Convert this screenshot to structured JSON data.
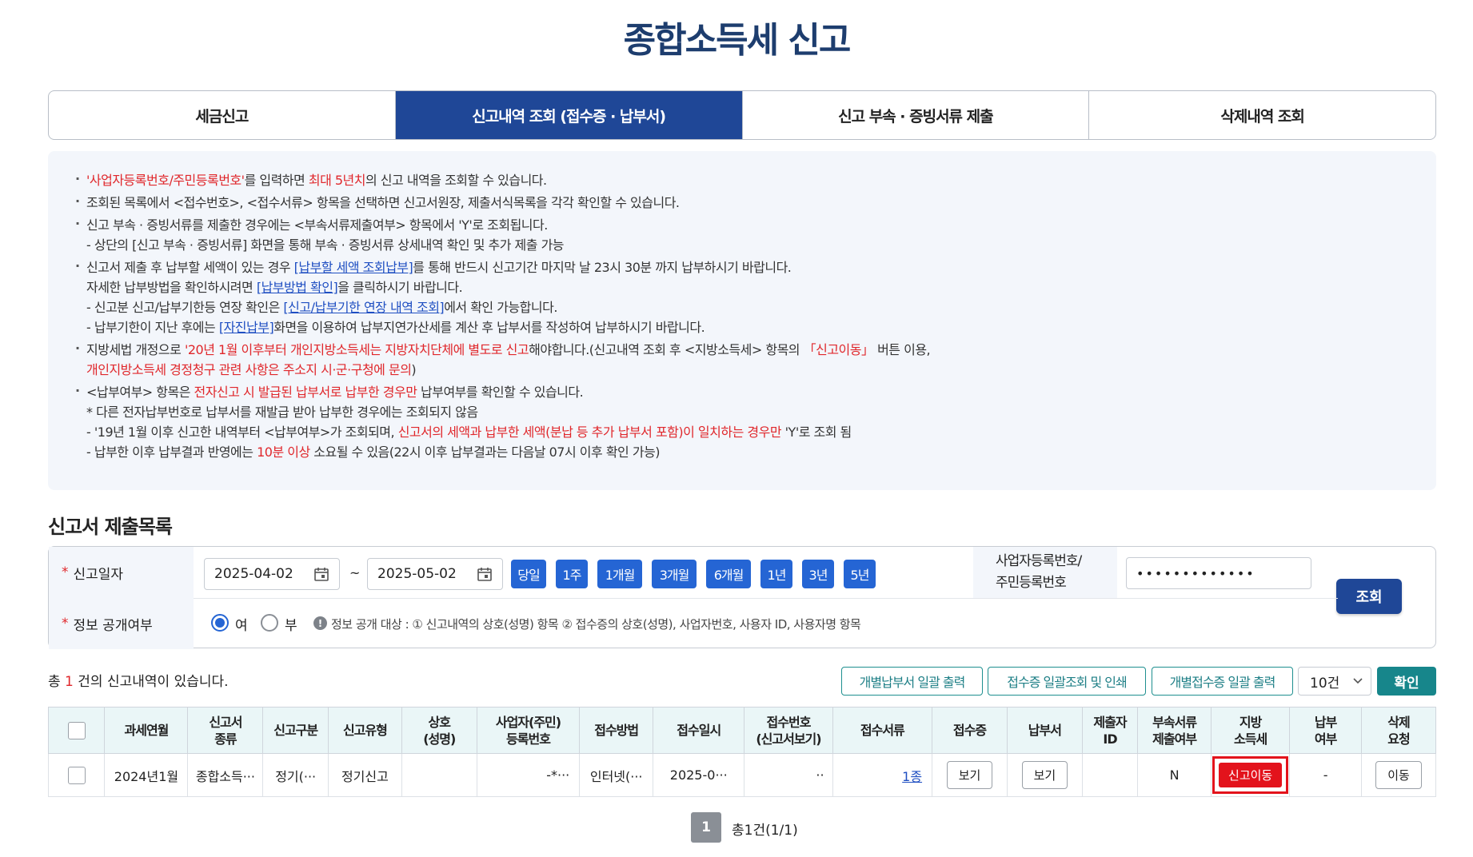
{
  "page": {
    "title": "종합소득세 신고"
  },
  "tabs": [
    {
      "label": "세금신고",
      "active": false
    },
    {
      "label": "신고내역 조회 (접수증 · 납부서)",
      "active": true
    },
    {
      "label": "신고 부속 · 증빙서류 제출",
      "active": false
    },
    {
      "label": "삭제내역 조회",
      "active": false
    }
  ],
  "notice": {
    "l1_a": "'사업자등록번호/주민등록번호'",
    "l1_b": "를 입력하면 ",
    "l1_c": "최대 5년치",
    "l1_d": "의 신고 내역을 조회할 수 있습니다.",
    "l2": "조회된 목록에서 <접수번호>, <접수서류> 항목을 선택하면 신고서원장, 제출서식목록을 각각 확인할 수 있습니다.",
    "l3": "신고 부속 · 증빙서류를 제출한 경우에는 <부속서류제출여부> 항목에서 'Y'로 조회됩니다.",
    "l3_sub": "- 상단의 [신고 부속 · 증빙서류] 화면을 통해 부속 · 증빙서류 상세내역 확인 및 추가 제출 가능",
    "l4_a": "신고서 제출 후 납부할 세액이 있는 경우 ",
    "l4_link": "[납부할 세액 조회납부]",
    "l4_b": "를 통해 반드시 신고기간 마지막 날 23시 30분 까지 납부하시기 바랍니다.",
    "l4_2a": "자세한 납부방법을 확인하시려면 ",
    "l4_2link": "[납부방법 확인]",
    "l4_2b": "을 클릭하시기 바랍니다.",
    "l4_3a": "- 신고분 신고/납부기한등 연장 확인은 ",
    "l4_3link": "[신고/납부기한 연장 내역 조회]",
    "l4_3b": "에서 확인 가능합니다.",
    "l4_4a": "- 납부기한이 지난 후에는 ",
    "l4_4link": "[자진납부]",
    "l4_4b": "화면을 이용하여 납부지연가산세를 계산 후 납부서를 작성하여 납부하시기 바랍니다.",
    "l5_a": "지방세법 개정으로 ",
    "l5_red": "'20년 1월 이후부터 개인지방소득세는 지방자치단체에 별도로 신고",
    "l5_b": "해야합니다.(신고내역 조회 후 <지방소득세> 항목의 ",
    "l5_red2": "「신고이동」",
    "l5_c": " 버튼 이용,",
    "l5_2red": "개인지방소득세 경정청구 관련 사항은 주소지 시·군·구청에 문의",
    "l5_2b": ")",
    "l6_a": "<납부여부> 항목은 ",
    "l6_red": "전자신고 시 발급된 납부서로 납부한 경우만",
    "l6_b": " 납부여부를 확인할 수 있습니다.",
    "l6_2": " * 다른 전자납부번호로 납부서를 재발급 받아 납부한 경우에는 조회되지 않음",
    "l6_3a": "- '19년 1월 이후 신고한 내역부터 <납부여부>가 조회되며, ",
    "l6_3red": "신고서의 세액과 납부한 세액(분납 등 추가 납부서 포함)이 일치하는 경우만",
    "l6_3b": " 'Y'로 조회 됨",
    "l6_4a": "- 납부한 이후 납부결과 반영에는 ",
    "l6_4red": "10분 이상",
    "l6_4b": " 소요될 수 있음(22시 이후 납부결과는 다음날 07시 이후 확인 가능)"
  },
  "list_section": {
    "title": "신고서 제출목록"
  },
  "search": {
    "date_label": "신고일자",
    "date_from": "2025-04-02",
    "tilde": "~",
    "date_to": "2025-05-02",
    "periods": [
      "당일",
      "1주",
      "1개월",
      "3개월",
      "6개월",
      "1년",
      "3년",
      "5년"
    ],
    "id_label_1": "사업자등록번호/",
    "id_label_2": "주민등록번호",
    "id_value": "•••••••••••••",
    "query_label": "조회",
    "disclose_label": "정보 공개여부",
    "yes_label": "여",
    "no_label": "부",
    "disclose_selected": "여",
    "disclose_note": "정보 공개 대상 : ① 신고내역의 상호(성명) 항목 ② 접수증의 상호(성명), 사업자번호, 사용자 ID, 사용자명 항목"
  },
  "results": {
    "count_prefix": "총 ",
    "count": "1",
    "count_suffix": " 건의 신고내역이 있습니다.",
    "btn_bulk_payment": "개별납부서 일괄 출력",
    "btn_receipt_bulk": "접수증 일괄조회 및 인쇄",
    "btn_individual_receipt": "개별접수증 일괄 출력",
    "page_size": "10건",
    "confirm_label": "확인"
  },
  "table": {
    "headers": [
      "",
      "과세연월",
      "신고서\n종류",
      "신고구분",
      "신고유형",
      "상호\n(성명)",
      "사업자(주민)\n등록번호",
      "접수방법",
      "접수일시",
      "접수번호\n(신고서보기)",
      "접수서류",
      "접수증",
      "납부서",
      "제출자\nID",
      "부속서류\n제출여부",
      "지방\n소득세",
      "납부\n여부",
      "삭제\n요청"
    ],
    "rows": [
      {
        "period": "2024년1월",
        "form_type": "종합소득···",
        "category": "정기(···",
        "filing_type": "정기신고",
        "name": "",
        "reg_no": "-*···",
        "method": "인터넷(···",
        "received_at": "2025-0···",
        "receipt_no": "··",
        "documents": "1종",
        "receipt_btn": "보기",
        "payment_btn": "보기",
        "submitter_id": "",
        "attach_submitted": "N",
        "local_tax_btn": "신고이동",
        "paid": "-",
        "delete_btn": "이동"
      }
    ]
  },
  "pagination": {
    "current": "1",
    "total_text": "총1건(1/1)"
  },
  "colors": {
    "brand": "#1f4797",
    "accent_blue": "#2565d4",
    "teal": "#17868b",
    "red": "#e3131c"
  },
  "icons": {
    "calendar": "calendar-icon",
    "info": "info-icon",
    "chevron": "chevron-down-icon"
  }
}
